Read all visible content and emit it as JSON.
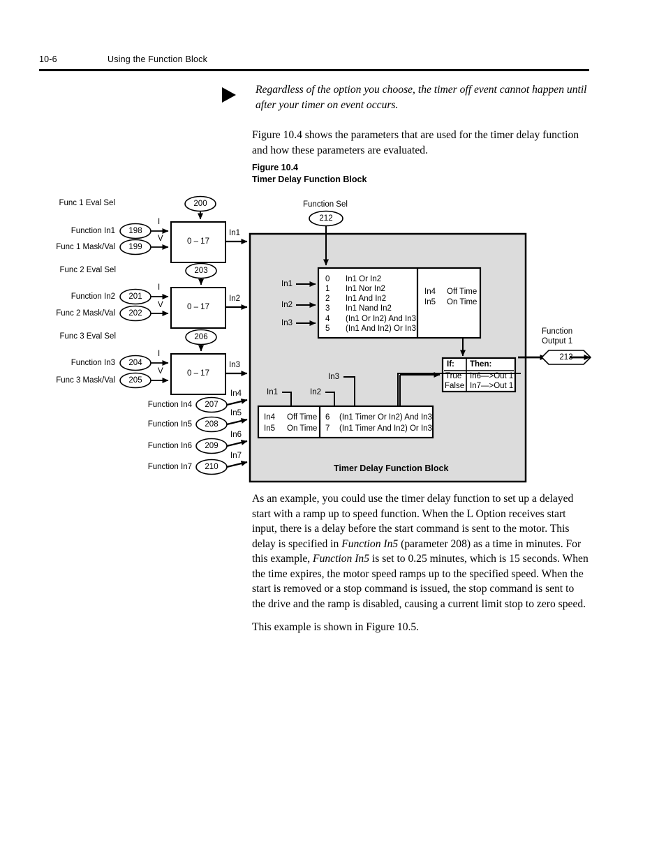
{
  "header": {
    "page_number": "10-6",
    "chapter_title": "Using the Function Block"
  },
  "note": {
    "icon": "triangle-bullet-icon",
    "text": "Regardless of the option you choose, the timer off event cannot happen until after your timer on event occurs."
  },
  "intro_paragraph": "Figure 10.4 shows the parameters that are used for the timer delay function and how these parameters are evaluated.",
  "figure": {
    "number_label": "Figure 10.4",
    "title_label": "Timer Delay Function Block",
    "block_title": "Timer Delay Function Block",
    "eval_blocks": [
      {
        "eval_sel_label": "Func 1 Eval Sel",
        "eval_sel_param": "200",
        "input_label": "Function In1",
        "input_param": "198",
        "mask_label": "Func 1 Mask/Val",
        "mask_param": "199",
        "i_marker": "I",
        "v_marker": "V",
        "range": "0 – 17",
        "output_label": "In1"
      },
      {
        "eval_sel_label": "Func 2 Eval Sel",
        "eval_sel_param": "203",
        "input_label": "Function In2",
        "input_param": "201",
        "mask_label": "Func 2 Mask/Val",
        "mask_param": "202",
        "i_marker": "I",
        "v_marker": "V",
        "range": "0 – 17",
        "output_label": "In2"
      },
      {
        "eval_sel_label": "Func 3 Eval Sel",
        "eval_sel_param": "206",
        "input_label": "Function In3",
        "input_param": "204",
        "mask_label": "Func 3 Mask/Val",
        "mask_param": "205",
        "i_marker": "I",
        "v_marker": "V",
        "range": "0 – 17",
        "output_label": "In3"
      }
    ],
    "direct_inputs": [
      {
        "label": "Function In4",
        "param": "207",
        "signal": "In4"
      },
      {
        "label": "Function In5",
        "param": "208",
        "signal": "In5"
      },
      {
        "label": "Function In6",
        "param": "209",
        "signal": "In6"
      },
      {
        "label": "Function In7",
        "param": "210",
        "signal": "In7"
      }
    ],
    "function_sel": {
      "label": "Function Sel",
      "param": "212"
    },
    "logic_table": {
      "signal_inputs": [
        "In1",
        "In2",
        "In3"
      ],
      "rows": [
        {
          "code": "0",
          "expr": "In1 Or In2"
        },
        {
          "code": "1",
          "expr": "In1 Nor In2"
        },
        {
          "code": "2",
          "expr": "In1 And In2"
        },
        {
          "code": "3",
          "expr": "In1 Nand In2"
        },
        {
          "code": "4",
          "expr": "(In1 Or In2) And In3"
        },
        {
          "code": "5",
          "expr": "(In1 And In2) Or In3"
        }
      ],
      "timer_rows": [
        {
          "signal": "In4",
          "expr": "Off Time"
        },
        {
          "signal": "In5",
          "expr": "On Time"
        }
      ]
    },
    "timer_table": {
      "timer_rows": [
        {
          "signal": "In4",
          "expr": "Off Time"
        },
        {
          "signal": "In5",
          "expr": "On Time"
        }
      ],
      "rows": [
        {
          "code": "6",
          "expr": "(In1 Timer Or In2) And In3"
        },
        {
          "code": "7",
          "expr": "(In1 Timer And In2) Or In3"
        }
      ],
      "tap_labels": [
        "In1",
        "In2",
        "In3"
      ]
    },
    "if_then_table": {
      "col_if": "If:",
      "col_then": "Then:",
      "rows": [
        {
          "cond": "True",
          "action": "In6—>Out 1"
        },
        {
          "cond": "False",
          "action": "In7—>Out 1"
        }
      ]
    },
    "output": {
      "label_line1": "Function",
      "label_line2": "Output 1",
      "param": "213"
    },
    "colors": {
      "block_fill": "#dcdcdc",
      "table_fill": "#ffffff",
      "line": "#000000"
    }
  },
  "example_paragraph_part1": "As an example, you could use the timer delay function to set up a delayed start with a ramp up to speed function. When the L Option receives start input, there is a delay before the start command is sent to the motor. This delay is specified in ",
  "example_paragraph_em1": "Function In5",
  "example_paragraph_part2": " (parameter 208) as a time in minutes. For this example, ",
  "example_paragraph_em2": "Function In5",
  "example_paragraph_part3": " is set to 0.25 minutes, which is 15 seconds. When the time expires, the motor speed ramps up to the specified speed. When the start is removed or a stop command is issued, the stop command is sent to the drive and the ramp is disabled, causing a current limit stop to zero speed.",
  "closing_paragraph": "This example is shown in Figure 10.5."
}
